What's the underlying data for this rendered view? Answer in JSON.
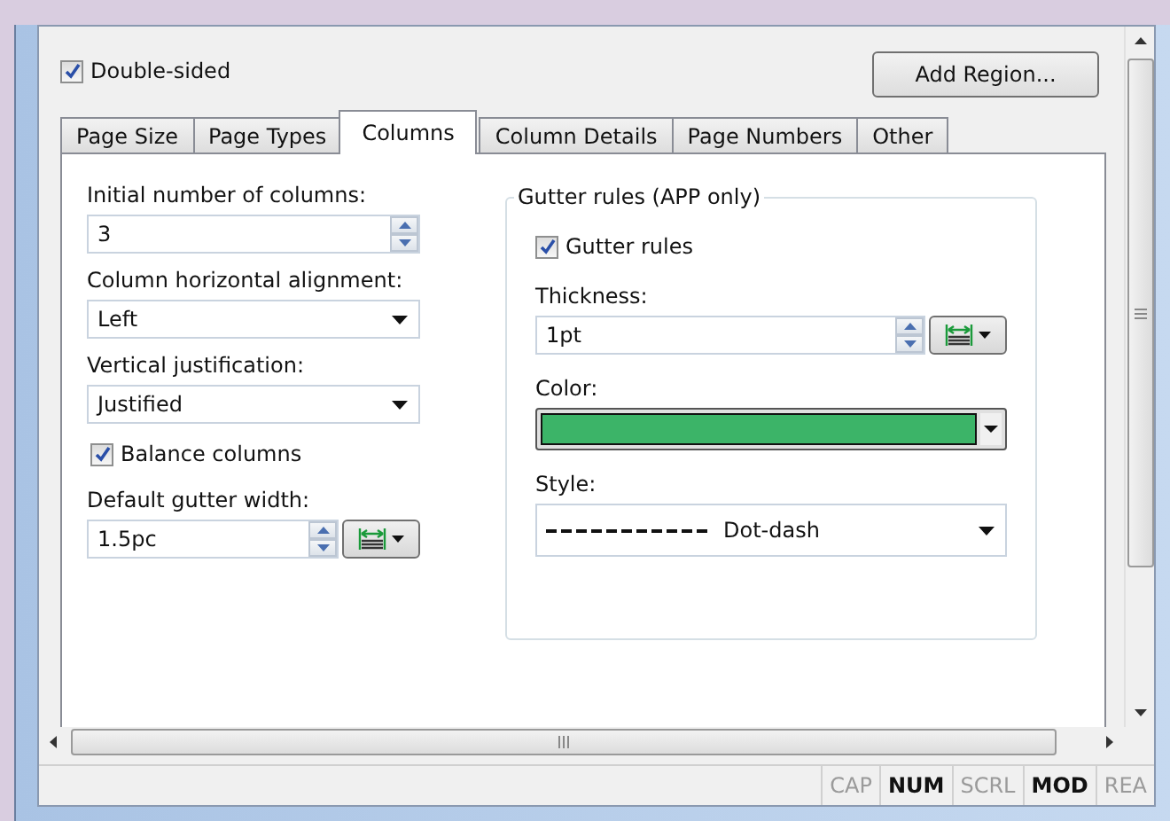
{
  "double_sided": {
    "label": "Double-sided",
    "checked": true
  },
  "add_region_button": "Add Region...",
  "tabs": [
    {
      "label": "Page Size",
      "selected": false
    },
    {
      "label": "Page Types",
      "selected": false
    },
    {
      "label": "Columns",
      "selected": true
    },
    {
      "label": "Column Details",
      "selected": false
    },
    {
      "label": "Page Numbers",
      "selected": false
    },
    {
      "label": "Other",
      "selected": false
    }
  ],
  "left": [
    {
      "kind": "spin",
      "label": "Initial number of columns:",
      "value": "3"
    },
    {
      "kind": "dropdown",
      "label": "Column horizontal alignment:",
      "value": "Left"
    },
    {
      "kind": "dropdown",
      "label": "Vertical justification:",
      "value": "Justified"
    },
    {
      "kind": "checkbox",
      "label": "Balance columns",
      "checked": true
    },
    {
      "kind": "unitspin",
      "label": "Default gutter width:",
      "value": "1.5pc"
    }
  ],
  "gutter_group": {
    "title": "Gutter rules (APP only)",
    "items": [
      {
        "kind": "checkbox",
        "label": "Gutter rules",
        "checked": true
      },
      {
        "kind": "unitspin",
        "label": "Thickness:",
        "value": "1pt"
      },
      {
        "kind": "color",
        "label": "Color:",
        "color": "#3cb468"
      },
      {
        "kind": "linestyle",
        "label": "Style:",
        "value": "Dot-dash"
      }
    ]
  },
  "status_bar": [
    {
      "label": "CAP",
      "on": false
    },
    {
      "label": "NUM",
      "on": true
    },
    {
      "label": "SCRL",
      "on": false
    },
    {
      "label": "MOD",
      "on": true
    },
    {
      "label": "REA",
      "on": false
    }
  ]
}
